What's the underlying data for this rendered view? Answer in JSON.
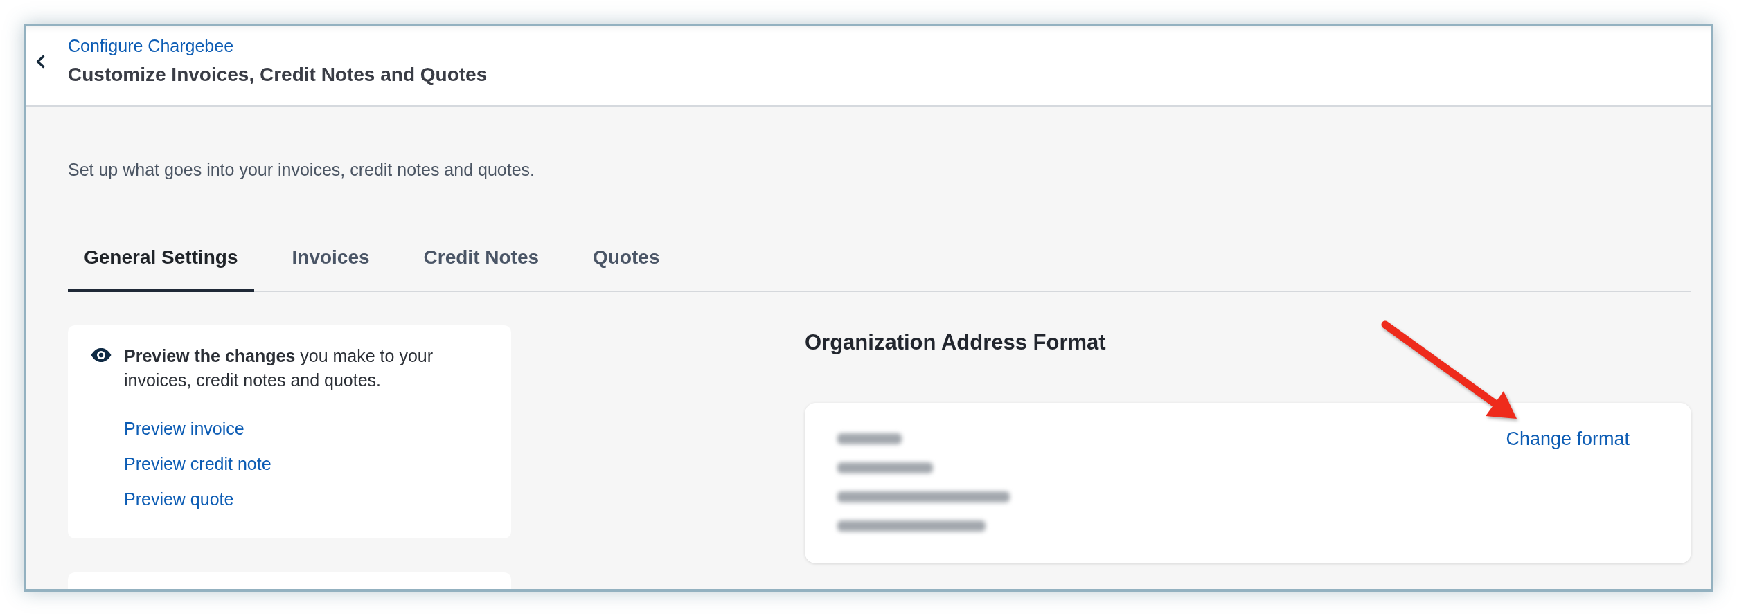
{
  "header": {
    "breadcrumb": "Configure Chargebee",
    "title": "Customize Invoices, Credit Notes and Quotes"
  },
  "description": "Set up what goes into your invoices, credit notes and quotes.",
  "tabs": [
    {
      "label": "General Settings",
      "selected": true
    },
    {
      "label": "Invoices",
      "selected": false
    },
    {
      "label": "Credit Notes",
      "selected": false
    },
    {
      "label": "Quotes",
      "selected": false
    }
  ],
  "preview_card": {
    "text": "**Preview the changes** you make to your invoices, credit notes and quotes.",
    "links": [
      "Preview invoice",
      "Preview credit note",
      "Preview quote"
    ]
  },
  "address_format": {
    "heading": "Organization Address Format",
    "action": "Change format"
  }
}
